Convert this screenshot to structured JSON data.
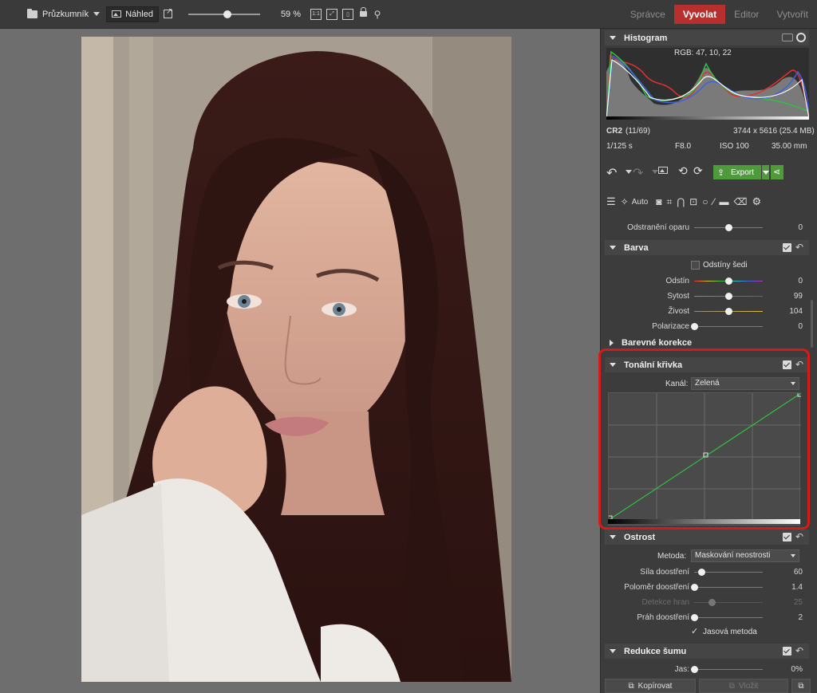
{
  "topbar": {
    "browser_label": "Průzkumník",
    "preview_label": "Náhled",
    "zoom_value": "59 %",
    "zoom_slider_fraction": 0.55,
    "one_to_one": "1:1",
    "modes": [
      "Správce",
      "Vyvolat",
      "Editor",
      "Vytvořit"
    ],
    "active_mode": "Vyvolat"
  },
  "histogram": {
    "title": "Histogram",
    "rgb_readout": "RGB: 47, 10, 22"
  },
  "fileinfo": {
    "format": "CR2",
    "index": "(11/69)",
    "dimensions": "3744 x 5616 (25.4 MB)",
    "shutter": "1/125 s",
    "aperture": "F8.0",
    "iso": "ISO 100",
    "focal": "35.00 mm"
  },
  "toolbar": {
    "export_label": "Export",
    "auto_label": "Auto"
  },
  "partial_row": {
    "label": "Odstranění oparu",
    "value": "0",
    "fraction": 0.5
  },
  "barva": {
    "title": "Barva",
    "grayscale_label": "Odstíny šedi",
    "rows": [
      {
        "label": "Odstín",
        "value": "0",
        "fraction": 0.5
      },
      {
        "label": "Sytost",
        "value": "99",
        "fraction": 0.5
      },
      {
        "label": "Živost",
        "value": "104",
        "fraction": 0.5
      },
      {
        "label": "Polarizace",
        "value": "0",
        "fraction": 0.0
      }
    ]
  },
  "barevne_korekce": {
    "title": "Barevné korekce"
  },
  "tonal_curve": {
    "title": "Tonální křivka",
    "channel_label": "Kanál:",
    "channel_value": "Zelená"
  },
  "ostrost": {
    "title": "Ostrost",
    "method_label": "Metoda:",
    "method_value": "Maskování neostrosti",
    "rows": [
      {
        "label": "Síla doostření",
        "value": "60",
        "fraction": 0.1,
        "dim": false
      },
      {
        "label": "Poloměr doostření",
        "value": "1.4",
        "fraction": 0.0,
        "dim": false
      },
      {
        "label": "Detekce hran",
        "value": "25",
        "fraction": 0.25,
        "dim": true
      },
      {
        "label": "Práh doostření",
        "value": "2",
        "fraction": 0.0,
        "dim": false
      }
    ],
    "luminance_label": "Jasová metoda"
  },
  "redukce_sumu": {
    "title": "Redukce šumu",
    "row": {
      "label": "Jas:",
      "value": "0%",
      "fraction": 0.0
    }
  },
  "bottom": {
    "copy_label": "Kopírovat",
    "paste_label": "Vložit"
  },
  "colors": {
    "accent_red": "#b8302e",
    "export_green": "#4f9a3b",
    "highlight_red": "#d51a1a"
  }
}
